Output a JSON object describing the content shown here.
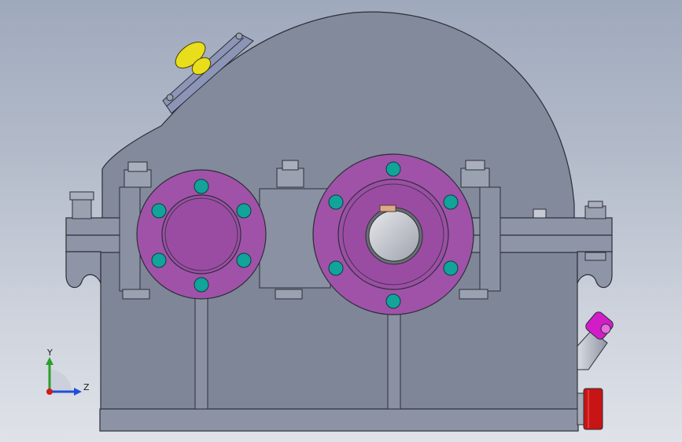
{
  "viewport": {
    "background_top": "#9fa9bc",
    "background_bottom": "#dfe2e8"
  },
  "model": {
    "housing_color": "#838a9c",
    "housing_edge_color": "#2b2f38",
    "flange_color": "#a052a8",
    "bolt_color": "#12a39a",
    "breather_color": "#e8de1c",
    "sight_gauge_color": "#d21cc8",
    "drain_plug_color": "#c81414",
    "shaft_color": "#c9ccd3"
  },
  "triad": {
    "y_label": "Y",
    "z_label": "Z",
    "y_color": "#2aa02a",
    "z_color": "#1f4fd6",
    "x_color": "#d21a1a"
  }
}
